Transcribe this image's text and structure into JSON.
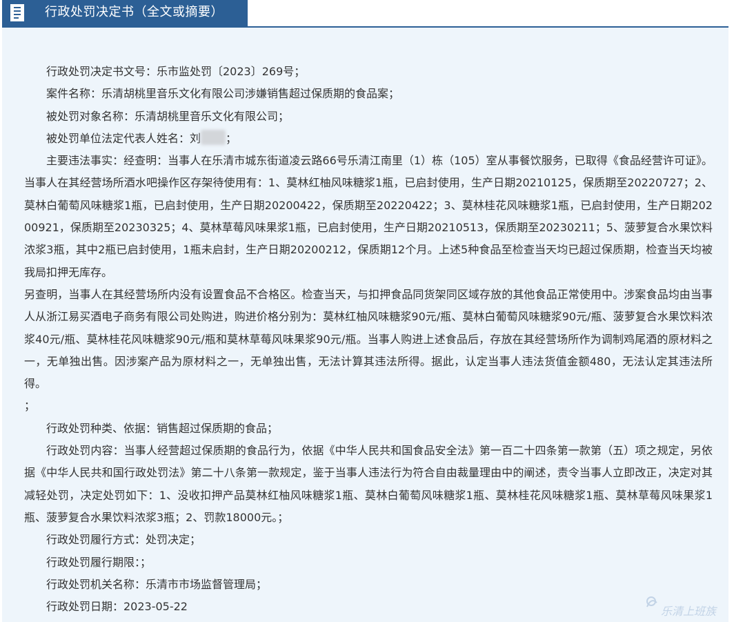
{
  "header": {
    "title": "行政处罚决定书（全文或摘要）",
    "icon": "document-icon",
    "accent_color": "#2c5f95"
  },
  "document": {
    "doc_number": " 行政处罚决定书文号：乐市监处罚〔2023〕269号；",
    "case_name": "案件名称：乐清胡桃里音乐文化有限公司涉嫌销售超过保质期的食品案；",
    "subject_name": "被处罚对象名称：乐清胡桃里音乐文化有限公司；",
    "legal_rep_prefix": "被处罚单位法定代表人姓名：刘",
    "legal_rep_suffix": "；",
    "facts_1": "主要违法事实：经查明：当事人在乐清市城东街道凌云路66号乐清江南里（1）栋（105）室从事餐饮服务，已取得《食品经营许可证》。当事人在其经营场所酒水吧操作区存架待使用有：1、莫林红柚风味糖浆1瓶，已启封使用，生产日期20210125，保质期至20220727；2、莫林白葡萄风味糖浆1瓶，已启封使用，生产日期20200422，保质期至20220422；3、莫林桂花风味糖浆1瓶，已启封使用，生产日期20200921，保质期至20230325；4、莫林草莓风味果浆1瓶，已启封使用，生产日期20210513，保质期至20230211；5、菠萝复合水果饮料浓浆3瓶，其中2瓶已启封使用，1瓶未启封，生产日期20200212，保质期12个月。上述5种食品至检查当天均已超过保质期，检查当天均被我局扣押无库存。",
    "facts_2": "另查明，当事人在其经营场所内没有设置食品不合格区。检查当天，与扣押食品同货架同区域存放的其他食品正常使用中。涉案食品均由当事人从浙江易买酒电子商务有限公司处购进，购进价格分别为：莫林红柚风味糖浆90元/瓶、莫林白葡萄风味糖浆90元/瓶、菠萝复合水果饮料浓浆40元/瓶、莫林桂花风味糖浆90元/瓶和莫林草莓风味果浆90元/瓶。当事人购进上述食品后，存放在其经营场所作为调制鸡尾酒的原材料之一，无单独出售。因涉案产品为原材料之一，无单独出售，无法计算其违法所得。据此，认定当事人违法货值金额480，无法认定其违法所得。",
    "facts_end": "；",
    "penalty_type": "行政处罚种类、依据：销售超过保质期的食品；",
    "penalty_content": "行政处罚内容：当事人经营超过保质期的食品行为，依据《中华人民共和国食品安全法》第一百二十四条第一款第（五）项之规定，另依据《中华人民共和国行政处罚法》第二十八条第一款规定，鉴于当事人违法行为符合自由裁量理由中的阐述，责令当事人立即改正，决定对其减轻处罚，决定处罚如下：1、没收扣押产品莫林红柚风味糖浆1瓶、莫林白葡萄风味糖浆1瓶、莫林桂花风味糖浆1瓶、莫林草莓风味果浆1瓶、菠萝复合水果饮料浓浆3瓶；2、罚款18000元。；",
    "performance_method": "行政处罚履行方式：处罚决定；",
    "performance_deadline": "行政处罚履行期限：；",
    "authority": "行政处罚机关名称：乐清市市场监督管理局；",
    "date": "行政处罚日期：2023-05-22"
  },
  "watermark": {
    "text": "乐清上班族"
  }
}
